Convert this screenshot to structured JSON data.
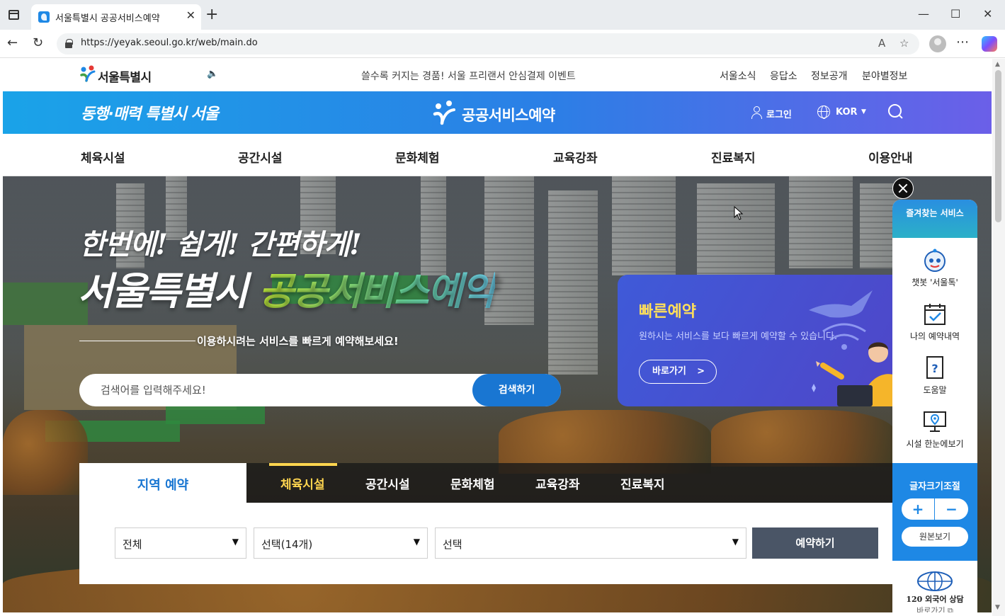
{
  "browser": {
    "tab_title": "서울특별시 공공서비스예약",
    "tab_close": "✕",
    "new_tab": "+",
    "url": "https://yeyak.seoul.go.kr/web/main.do",
    "window_controls": {
      "minimize": "—",
      "maximize": "☐",
      "close": "✕"
    },
    "nav": {
      "back": "←",
      "reload": "↻"
    },
    "actions": {
      "read_aloud": "A",
      "favorite": "☆",
      "menu": "⋯"
    }
  },
  "utility_bar": {
    "logo_text": "서울특별시",
    "notice": "쓸수록 커지는 경품! 서울 프리랜서 안심결제 이벤트",
    "links": [
      "서울소식",
      "응답소",
      "정보공개",
      "분야별정보"
    ]
  },
  "header": {
    "slogan": "동행·매력 특별시 서울",
    "service_name": "공공서비스예약",
    "login_label": "로그인",
    "language": "KOR",
    "colors": {
      "gradient_start": "#1aa3e8",
      "gradient_end": "#6b5fe8"
    }
  },
  "gnb": {
    "items": [
      "체육시설",
      "공간시설",
      "문화체험",
      "교육강좌",
      "진료복지",
      "이용안내"
    ]
  },
  "hero": {
    "line1": "한번에! 쉽게! 간편하게!",
    "line2_white": "서울특별시",
    "line2_green": "공공서비스예약",
    "subtitle": "이용하시려는 서비스를 빠르게 예약해보세요!",
    "search_placeholder": "검색어를 입력해주세요!",
    "search_button": "검색하기"
  },
  "quick_reservation": {
    "title": "빠른예약",
    "description": "원하시는 서비스를 보다 빠르게 예약할 수 있습니다.",
    "go_button": "바로가기",
    "go_chevron": ">"
  },
  "reservation": {
    "region_tab": "지역 예약",
    "categories": [
      "체육시설",
      "공간시설",
      "문화체험",
      "교육강좌",
      "진료복지"
    ],
    "active_category": "체육시설",
    "selects": [
      {
        "value": "전체"
      },
      {
        "value": "선택(14개)"
      },
      {
        "value": "선택"
      }
    ],
    "submit": "예약하기"
  },
  "quick_menu": {
    "title": "즐겨찾는 서비스",
    "items": [
      "챗봇 '서울톡'",
      "나의 예약내역",
      "도움말",
      "시설 한눈에보기"
    ],
    "font_size_title": "글자크기조절",
    "font_plus": "+",
    "font_minus": "−",
    "font_reset": "원본보기",
    "foreign_label": "120 외국어 상담",
    "foreign_go": "바로가기 ⧉"
  },
  "icons": {
    "speaker": "🔈",
    "caret": "▼"
  }
}
